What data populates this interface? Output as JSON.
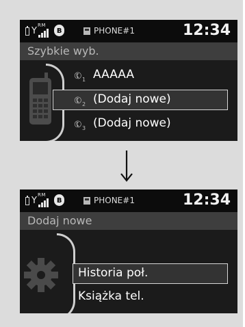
{
  "status": {
    "roaming": "RM",
    "bluetooth_icon": "bluetooth-icon",
    "phone_name": "PHONE#1",
    "time": "12:34"
  },
  "screen1": {
    "title": "Szybkie wyb.",
    "items": [
      {
        "number": "1",
        "label": "AAAAA"
      },
      {
        "number": "2",
        "label": "(Dodaj nowe)"
      },
      {
        "number": "3",
        "label": "(Dodaj nowe)"
      }
    ]
  },
  "screen2": {
    "title": "Dodaj nowe",
    "items": [
      {
        "label": "Historia poł."
      },
      {
        "label": "Książka tel."
      }
    ]
  },
  "colors": {
    "screen_bg": "#1b1b1b",
    "title_bar": "#3e3e3e",
    "highlight_border": "#d7d7d7"
  }
}
